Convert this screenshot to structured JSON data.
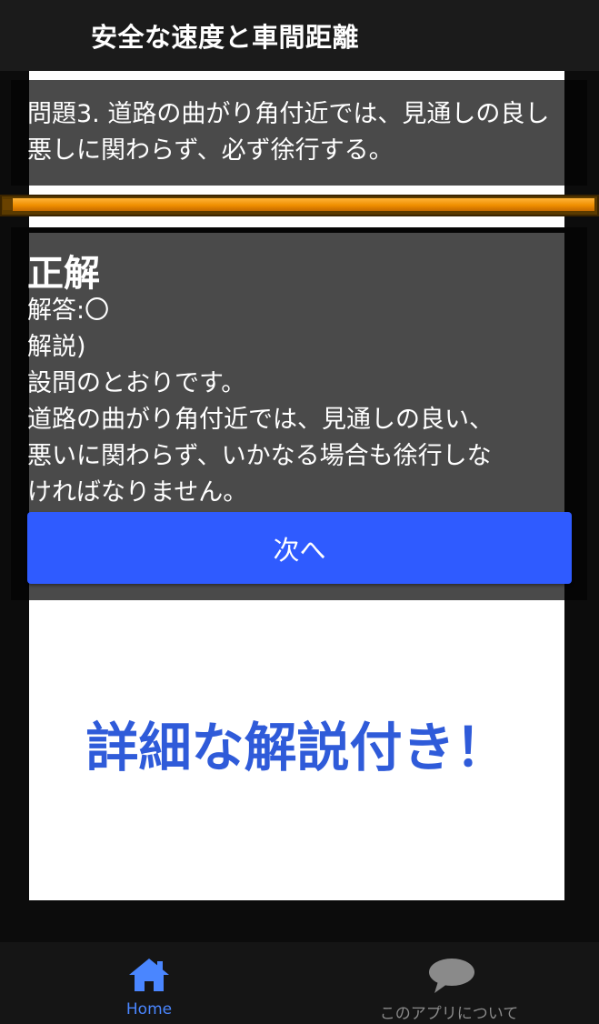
{
  "app": {
    "title": "安全な速度と車間距離"
  },
  "question": {
    "text": "問題3. 道路の曲がり角付近では、見通しの良し悪しに関わらず、必ず徐行する。"
  },
  "progress": {
    "fraction": 1.0
  },
  "answer": {
    "heading": "正解",
    "lines": [
      "解答:〇",
      "解説)",
      "設問のとおりです。",
      "道路の曲がり角付近では、見通しの良い、",
      "悪いに関わらず、いかなる場合も徐行しな",
      "ければなりません。"
    ]
  },
  "actions": {
    "next_label": "次へ"
  },
  "promo": {
    "text": "詳細な解説付き！"
  },
  "nav": {
    "home_label": "Home",
    "about_label": "このアプリについて",
    "home_icon": "home-icon",
    "about_icon": "chat-bubble-icon",
    "active_color": "#4a86ff",
    "inactive_color": "#8a8a8a"
  },
  "colors": {
    "accent_button": "#2f5bff",
    "promo_text": "#2f5bd9",
    "progress": "#f08f00"
  }
}
